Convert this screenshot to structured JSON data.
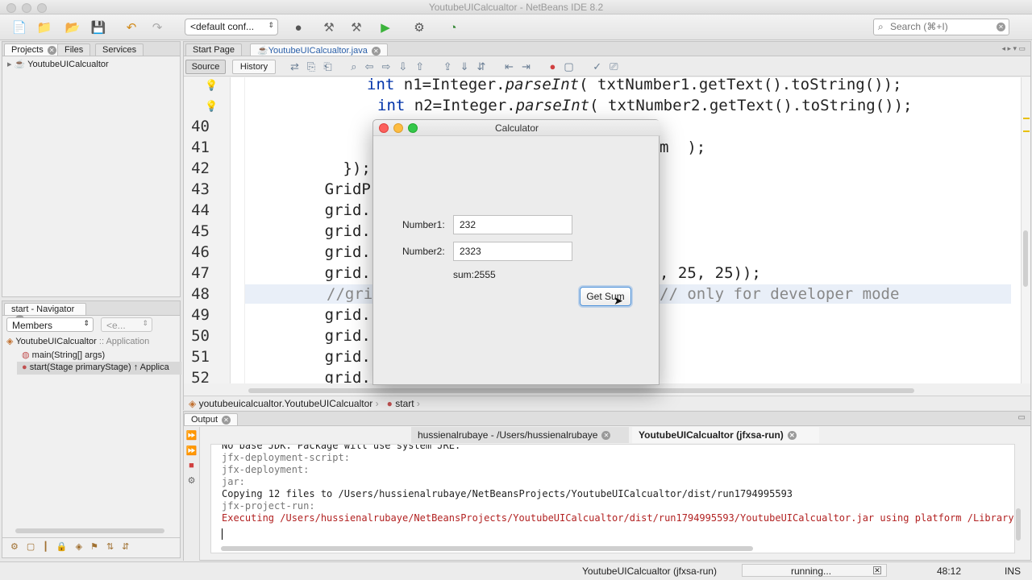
{
  "window": {
    "title": "YoutubeUICalcualtor - NetBeans IDE 8.2"
  },
  "toolbar": {
    "config": "<default conf...",
    "search_placeholder": "Search (⌘+I)"
  },
  "projects_panel": {
    "tabs": [
      "Projects",
      "Files",
      "Services"
    ],
    "tree_root": "YoutubeUICalcualtor"
  },
  "editor": {
    "tabs": [
      "Start Page",
      "YoutubeUICalcualtor.java"
    ],
    "source_label": "Source",
    "history_label": "History",
    "code_lines": [
      {
        "num": "",
        "text": ""
      },
      {
        "num": "",
        "text": ""
      },
      {
        "num": "40",
        "text": ""
      },
      {
        "num": "41",
        "text": ""
      },
      {
        "num": "42",
        "text": "        });"
      },
      {
        "num": "43",
        "text": "      GridP"
      },
      {
        "num": "44",
        "text": "      grid."
      },
      {
        "num": "45",
        "text": "      grid."
      },
      {
        "num": "46",
        "text": "      grid."
      },
      {
        "num": "47",
        "text": "      grid."
      },
      {
        "num": "48",
        "text": ""
      },
      {
        "num": "49",
        "text": "      grid."
      },
      {
        "num": "50",
        "text": "      grid."
      },
      {
        "num": "51",
        "text": "      grid."
      },
      {
        "num": "52",
        "text": "      grid."
      }
    ],
    "line38_kw": "int",
    "line38_rest1": " n1=Integer.",
    "line38_method": "parseInt",
    "line38_rest2": "( txtNumber1.getText().toString());",
    "line39_kw": "int",
    "line39_rest1": " n2=Integer.",
    "line39_method": "parseInt",
    "line39_rest2": "( txtNumber2.getText().toString());",
    "line41_tail": "m  );",
    "line47_tail": ", 25, 25));",
    "line48_comment_start": "//gri",
    "line48_comment_tail": "// only for developer mode",
    "breadcrumb_class": "youtubeuicalcualtor.YoutubeUICalcualtor",
    "breadcrumb_method": "start"
  },
  "navigator": {
    "title": "start - Navigator",
    "filter": "Members",
    "filter2": "<e...",
    "root": "YoutubeUICalcualtor",
    "root_suffix": ":: Application",
    "items": [
      "main(String[] args)",
      "start(Stage primaryStage) ↑ Applica"
    ]
  },
  "dialog": {
    "title": "Calculator",
    "number1_label": "Number1:",
    "number1_value": "232",
    "number2_label": "Number2:",
    "number2_value": "2323",
    "sum_text": "sum:2555",
    "button_label": "Get Sum"
  },
  "output": {
    "panel_title": "Output",
    "tabs": [
      "hussienalrubaye - /Users/hussienalrubaye",
      "YoutubeUICalcualtor (jfxsa-run)"
    ],
    "lines": [
      {
        "text": "No base JDK. Package will use system JRE.",
        "color": "#222222"
      },
      {
        "text": "jfx-deployment-script:",
        "color": "#777777"
      },
      {
        "text": "jfx-deployment:",
        "color": "#777777"
      },
      {
        "text": "jar:",
        "color": "#777777"
      },
      {
        "text": "Copying 12 files to /Users/hussienalrubaye/NetBeansProjects/YoutubeUICalcualtor/dist/run1794995593",
        "color": "#222222"
      },
      {
        "text": "jfx-project-run:",
        "color": "#777777"
      },
      {
        "text": "Executing /Users/hussienalrubaye/NetBeansProjects/YoutubeUICalcualtor/dist/run1794995593/YoutubeUICalcualtor.jar using platform /Library/J",
        "color": "#b22222"
      }
    ]
  },
  "status": {
    "task": "YoutubeUICalcualtor (jfxsa-run)",
    "state": "running...",
    "position": "48:12",
    "mode": "INS"
  }
}
